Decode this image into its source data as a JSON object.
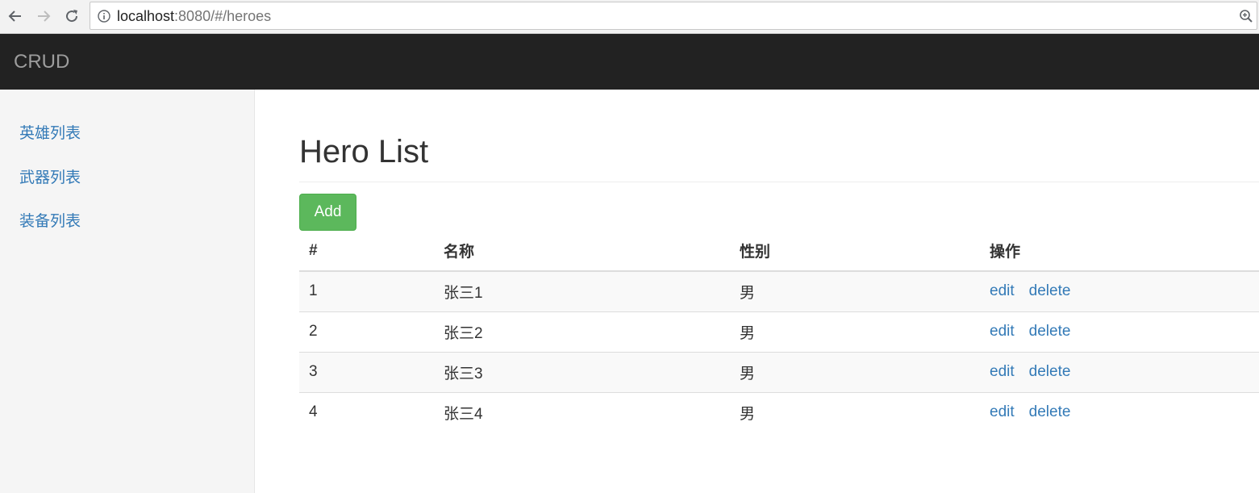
{
  "browser": {
    "url_host": "localhost",
    "url_rest": ":8080/#/heroes"
  },
  "navbar": {
    "brand": "CRUD"
  },
  "sidebar": {
    "items": [
      {
        "label": "英雄列表"
      },
      {
        "label": "武器列表"
      },
      {
        "label": "装备列表"
      }
    ]
  },
  "main": {
    "title": "Hero List",
    "add_label": "Add"
  },
  "table": {
    "headers": [
      "#",
      "名称",
      "性别",
      "操作"
    ],
    "rows": [
      {
        "id": "1",
        "name": "张三1",
        "gender": "男",
        "edit": "edit",
        "delete": "delete"
      },
      {
        "id": "2",
        "name": "张三2",
        "gender": "男",
        "edit": "edit",
        "delete": "delete"
      },
      {
        "id": "3",
        "name": "张三3",
        "gender": "男",
        "edit": "edit",
        "delete": "delete"
      },
      {
        "id": "4",
        "name": "张三4",
        "gender": "男",
        "edit": "edit",
        "delete": "delete"
      }
    ]
  },
  "colors": {
    "navbar_bg": "#222222",
    "link": "#337ab7",
    "success": "#5cb85c"
  },
  "icons": [
    "back-icon",
    "forward-icon",
    "reload-icon",
    "info-icon",
    "zoom-icon"
  ]
}
